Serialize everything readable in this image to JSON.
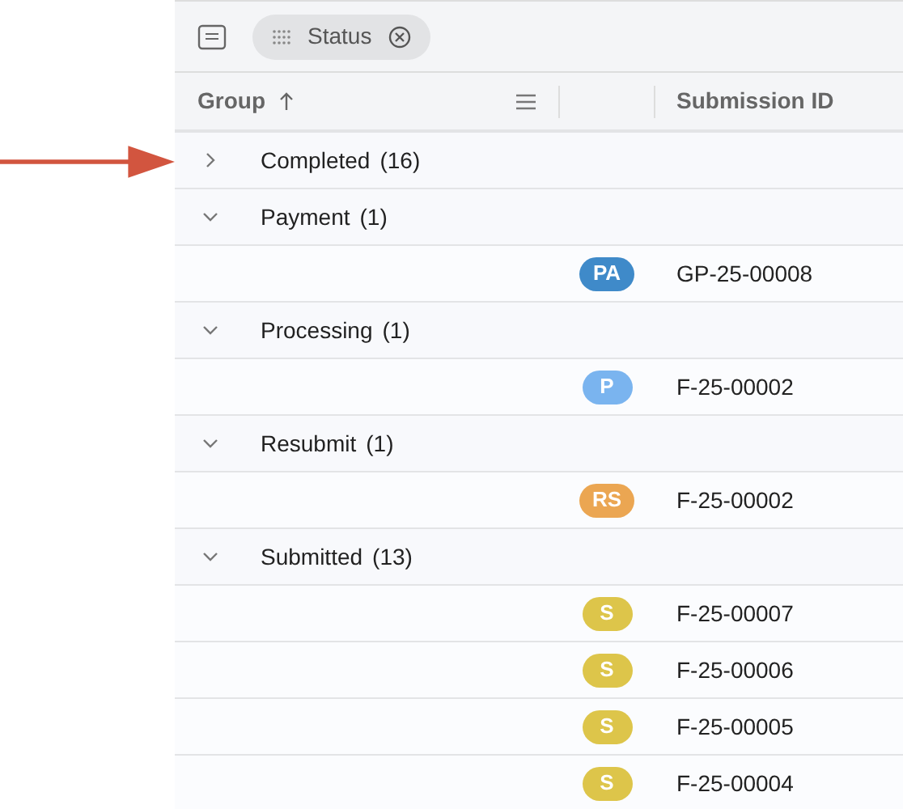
{
  "toolbar": {
    "group_chip": {
      "label": "Status"
    }
  },
  "table": {
    "columns": [
      {
        "label": "Group",
        "sorted": true
      },
      {
        "label": "Submission ID"
      }
    ],
    "groups": [
      {
        "label": "Completed",
        "count": "(16)",
        "expanded": false
      },
      {
        "label": "Payment",
        "count": "(1)",
        "expanded": true,
        "rows": [
          {
            "badge": "PA",
            "color": "#3f8ac9",
            "id": "GP-25-00008"
          }
        ]
      },
      {
        "label": "Processing",
        "count": "(1)",
        "expanded": true,
        "rows": [
          {
            "badge": "P",
            "color": "#7ab4ef",
            "id": "F-25-00002"
          }
        ]
      },
      {
        "label": "Resubmit",
        "count": "(1)",
        "expanded": true,
        "rows": [
          {
            "badge": "RS",
            "color": "#eba652",
            "id": "F-25-00002"
          }
        ]
      },
      {
        "label": "Submitted",
        "count": "(13)",
        "expanded": true,
        "rows": [
          {
            "badge": "S",
            "color": "#ddc54a",
            "id": "F-25-00007"
          },
          {
            "badge": "S",
            "color": "#ddc54a",
            "id": "F-25-00006"
          },
          {
            "badge": "S",
            "color": "#ddc54a",
            "id": "F-25-00005"
          },
          {
            "badge": "S",
            "color": "#ddc54a",
            "id": "F-25-00004"
          }
        ]
      }
    ]
  }
}
